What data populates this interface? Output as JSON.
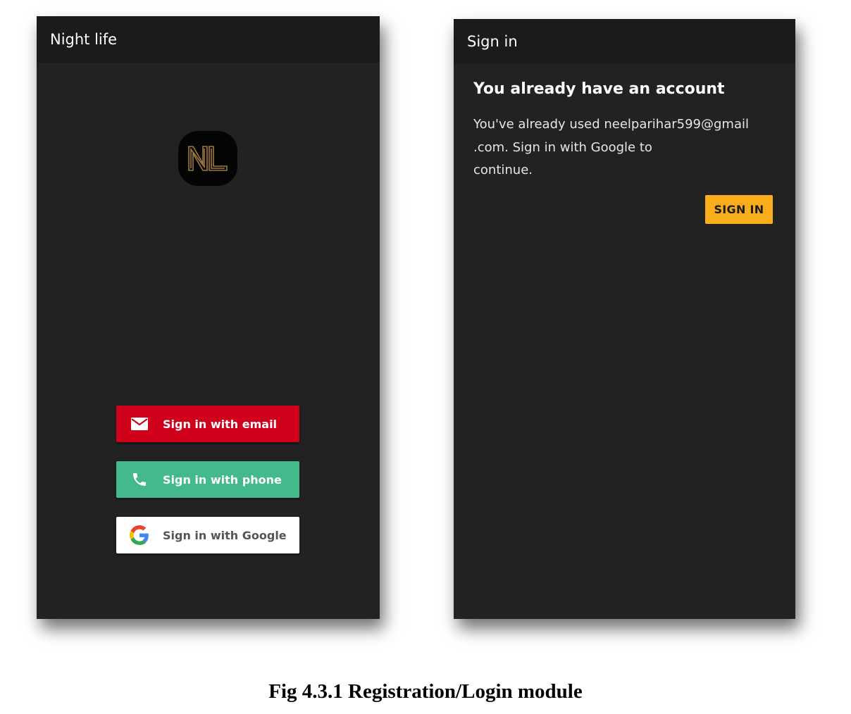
{
  "login_screen": {
    "title": "Night life",
    "logo_text": "NL",
    "buttons": [
      {
        "label": "Sign in with email",
        "icon": "email-icon",
        "color": "#d0021b"
      },
      {
        "label": "Sign in with phone",
        "icon": "phone-icon",
        "color": "#43b98c"
      },
      {
        "label": "Sign in with Google",
        "icon": "google-icon",
        "color": "#ffffff"
      }
    ]
  },
  "signin_screen": {
    "title": "Sign in",
    "dialog_title": "You already have an account",
    "dialog_line1": "You've already used neelparihar599@gmail",
    "dialog_line2": ".com. Sign in with Google to",
    "dialog_line3": "continue.",
    "signin_button": "SIGN IN",
    "accent_color": "#f9ad1a"
  },
  "caption": "Fig 4.3.1 Registration/Login module"
}
